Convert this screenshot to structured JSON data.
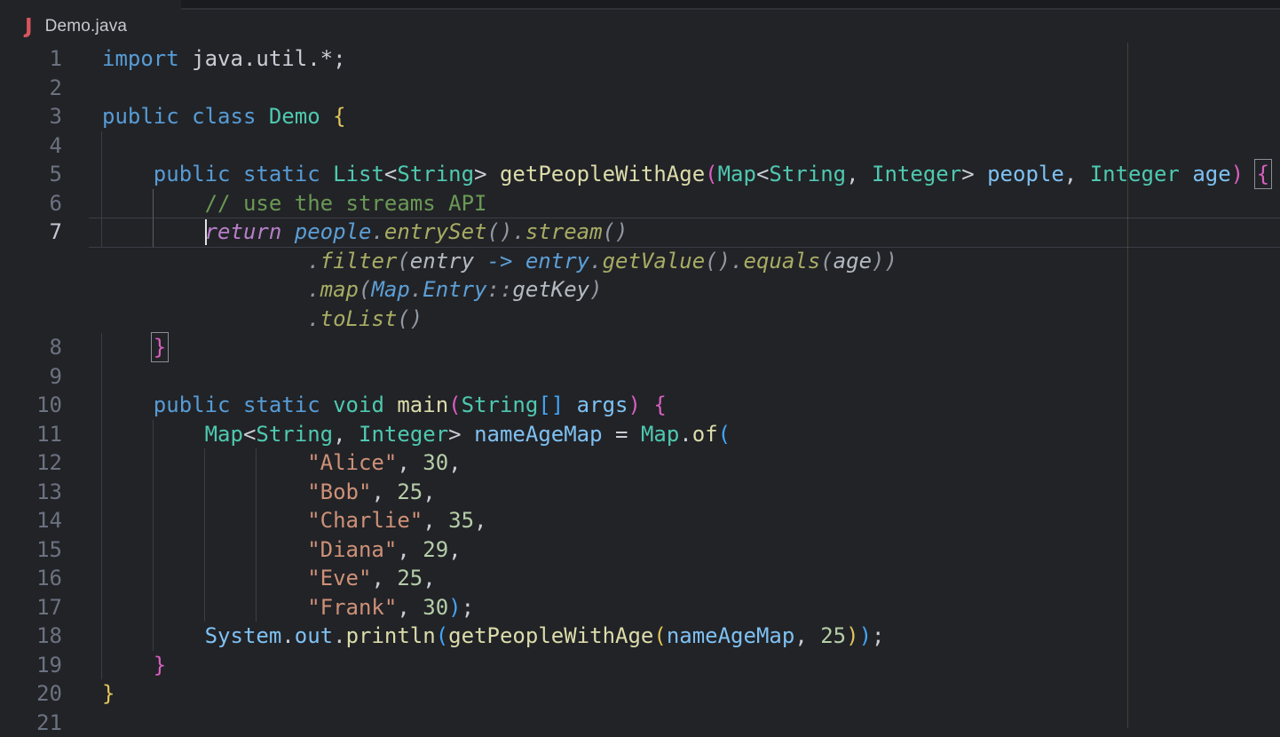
{
  "breadcrumb": {
    "file_icon": "J",
    "filename": "Demo.java"
  },
  "theme": {
    "colors": {
      "bg": "#222327",
      "tabbar": "#1a1b1f",
      "tabborder": "#2e3136",
      "crumb": "#c6c9ce",
      "javaicon": "#d6565e",
      "ln": "#6b7280",
      "lnActive": "#c2c8d2",
      "fg": "#c9cdd5",
      "kw": "#569cd6",
      "ty": "#4ec9b0",
      "fn": "#dcdcaa",
      "var": "#7ec1f2",
      "str": "#ce9178",
      "num": "#b5cea8",
      "com": "#6a9955",
      "b1": "#e2c55b",
      "b2": "#d75fc0",
      "b3": "#42a5f5",
      "gkw": "#b77ec9",
      "gvar": "#5c9fd6",
      "gfn": "#a8ac63",
      "gfg": "#b4bac2",
      "gpun": "#9298a1",
      "guide": "#3b3e45",
      "guideActive": "#585d66",
      "lineBorder": "#3a3e45",
      "match": "#8a8f97",
      "cursor": "#e0e2e6",
      "ruler": "rgba(110,160,110,0.28)"
    }
  },
  "editor": {
    "language": "java",
    "cursor": {
      "line": 7,
      "column": 8
    },
    "ruler_column": 80,
    "lines": [
      {
        "num": "1",
        "tokens": [
          [
            "kw",
            "import"
          ],
          [
            "fg",
            " java.util.*;"
          ]
        ]
      },
      {
        "num": "2",
        "tokens": []
      },
      {
        "num": "3",
        "tokens": [
          [
            "kw",
            "public"
          ],
          [
            "fg",
            " "
          ],
          [
            "kw",
            "class"
          ],
          [
            "fg",
            " "
          ],
          [
            "ty",
            "Demo"
          ],
          [
            "fg",
            " "
          ],
          [
            "b1",
            "{"
          ]
        ]
      },
      {
        "num": "4",
        "tokens": []
      },
      {
        "num": "5",
        "tokens": [
          [
            "fg",
            "    "
          ],
          [
            "kw",
            "public"
          ],
          [
            "fg",
            " "
          ],
          [
            "kw",
            "static"
          ],
          [
            "fg",
            " "
          ],
          [
            "ty",
            "List"
          ],
          [
            "fg",
            "<"
          ],
          [
            "ty",
            "String"
          ],
          [
            "fg",
            "> "
          ],
          [
            "fn",
            "getPeopleWithAge"
          ],
          [
            "b2",
            "("
          ],
          [
            "ty",
            "Map"
          ],
          [
            "fg",
            "<"
          ],
          [
            "ty",
            "String"
          ],
          [
            "fg",
            ", "
          ],
          [
            "ty",
            "Integer"
          ],
          [
            "fg",
            "> "
          ],
          [
            "var",
            "people"
          ],
          [
            "fg",
            ", "
          ],
          [
            "ty",
            "Integer"
          ],
          [
            "fg",
            " "
          ],
          [
            "var",
            "age"
          ],
          [
            "b2",
            ")"
          ],
          [
            "fg",
            " "
          ],
          [
            "b2 match",
            "{"
          ]
        ]
      },
      {
        "num": "6",
        "tokens": [
          [
            "fg",
            "        "
          ],
          [
            "com",
            "// use the streams API"
          ]
        ]
      },
      {
        "num": "7",
        "active": true,
        "tokens": [
          [
            "fg",
            "        "
          ],
          [
            "cursor",
            ""
          ],
          [
            "gkw",
            "return"
          ],
          [
            "gpun",
            " "
          ],
          [
            "gvar",
            "people"
          ],
          [
            "gpun",
            "."
          ],
          [
            "gfn",
            "entrySet"
          ],
          [
            "gpun",
            "()."
          ],
          [
            "gfn",
            "stream"
          ],
          [
            "gpun",
            "()"
          ]
        ]
      },
      {
        "ghost": true,
        "tokens": [
          [
            "gpun",
            "                ."
          ],
          [
            "gfn",
            "filter"
          ],
          [
            "gpun",
            "("
          ],
          [
            "gfg",
            "entry"
          ],
          [
            "gpun",
            " "
          ],
          [
            "gvar",
            "->"
          ],
          [
            "gpun",
            " "
          ],
          [
            "gvar",
            "entry"
          ],
          [
            "gpun",
            "."
          ],
          [
            "gfn",
            "getValue"
          ],
          [
            "gpun",
            "()."
          ],
          [
            "gfn",
            "equals"
          ],
          [
            "gpun",
            "("
          ],
          [
            "gfg",
            "age"
          ],
          [
            "gpun",
            "))"
          ]
        ]
      },
      {
        "ghost": true,
        "tokens": [
          [
            "gpun",
            "                ."
          ],
          [
            "gfn",
            "map"
          ],
          [
            "gpun",
            "("
          ],
          [
            "gvar",
            "Map"
          ],
          [
            "gpun",
            "."
          ],
          [
            "gvar",
            "Entry"
          ],
          [
            "gpun",
            "::"
          ],
          [
            "gfg",
            "getKey"
          ],
          [
            "gpun",
            ")"
          ]
        ]
      },
      {
        "ghost": true,
        "tokens": [
          [
            "gpun",
            "                ."
          ],
          [
            "gfn",
            "toList"
          ],
          [
            "gpun",
            "()"
          ]
        ]
      },
      {
        "num": "8",
        "tokens": [
          [
            "fg",
            "    "
          ],
          [
            "b2 match",
            "}"
          ]
        ]
      },
      {
        "num": "9",
        "tokens": []
      },
      {
        "num": "10",
        "tokens": [
          [
            "fg",
            "    "
          ],
          [
            "kw",
            "public"
          ],
          [
            "fg",
            " "
          ],
          [
            "kw",
            "static"
          ],
          [
            "fg",
            " "
          ],
          [
            "ty",
            "void"
          ],
          [
            "fg",
            " "
          ],
          [
            "fn",
            "main"
          ],
          [
            "b2",
            "("
          ],
          [
            "ty",
            "String"
          ],
          [
            "b3",
            "[]"
          ],
          [
            "fg",
            " "
          ],
          [
            "var",
            "args"
          ],
          [
            "b2",
            ")"
          ],
          [
            "fg",
            " "
          ],
          [
            "b2",
            "{"
          ]
        ]
      },
      {
        "num": "11",
        "tokens": [
          [
            "fg",
            "        "
          ],
          [
            "ty",
            "Map"
          ],
          [
            "fg",
            "<"
          ],
          [
            "ty",
            "String"
          ],
          [
            "fg",
            ", "
          ],
          [
            "ty",
            "Integer"
          ],
          [
            "fg",
            "> "
          ],
          [
            "var",
            "nameAgeMap"
          ],
          [
            "fg",
            " = "
          ],
          [
            "ty",
            "Map"
          ],
          [
            "fg",
            "."
          ],
          [
            "fn",
            "of"
          ],
          [
            "b3",
            "("
          ]
        ]
      },
      {
        "num": "12",
        "tokens": [
          [
            "fg",
            "                "
          ],
          [
            "str",
            "\"Alice\""
          ],
          [
            "fg",
            ", "
          ],
          [
            "num",
            "30"
          ],
          [
            "fg",
            ","
          ]
        ]
      },
      {
        "num": "13",
        "tokens": [
          [
            "fg",
            "                "
          ],
          [
            "str",
            "\"Bob\""
          ],
          [
            "fg",
            ", "
          ],
          [
            "num",
            "25"
          ],
          [
            "fg",
            ","
          ]
        ]
      },
      {
        "num": "14",
        "tokens": [
          [
            "fg",
            "                "
          ],
          [
            "str",
            "\"Charlie\""
          ],
          [
            "fg",
            ", "
          ],
          [
            "num",
            "35"
          ],
          [
            "fg",
            ","
          ]
        ]
      },
      {
        "num": "15",
        "tokens": [
          [
            "fg",
            "                "
          ],
          [
            "str",
            "\"Diana\""
          ],
          [
            "fg",
            ", "
          ],
          [
            "num",
            "29"
          ],
          [
            "fg",
            ","
          ]
        ]
      },
      {
        "num": "16",
        "tokens": [
          [
            "fg",
            "                "
          ],
          [
            "str",
            "\"Eve\""
          ],
          [
            "fg",
            ", "
          ],
          [
            "num",
            "25"
          ],
          [
            "fg",
            ","
          ]
        ]
      },
      {
        "num": "17",
        "tokens": [
          [
            "fg",
            "                "
          ],
          [
            "str",
            "\"Frank\""
          ],
          [
            "fg",
            ", "
          ],
          [
            "num",
            "30"
          ],
          [
            "b3",
            ")"
          ],
          [
            "fg",
            ";"
          ]
        ]
      },
      {
        "num": "18",
        "tokens": [
          [
            "fg",
            "        "
          ],
          [
            "var",
            "System"
          ],
          [
            "fg",
            "."
          ],
          [
            "var",
            "out"
          ],
          [
            "fg",
            "."
          ],
          [
            "fn",
            "println"
          ],
          [
            "b3",
            "("
          ],
          [
            "fn",
            "getPeopleWithAge"
          ],
          [
            "b1",
            "("
          ],
          [
            "var",
            "nameAgeMap"
          ],
          [
            "fg",
            ", "
          ],
          [
            "num",
            "25"
          ],
          [
            "b1",
            ")"
          ],
          [
            "b3",
            ")"
          ],
          [
            "fg",
            ";"
          ]
        ]
      },
      {
        "num": "19",
        "tokens": [
          [
            "fg",
            "    "
          ],
          [
            "b2",
            "}"
          ]
        ]
      },
      {
        "num": "20",
        "tokens": [
          [
            "b1",
            "}"
          ]
        ]
      },
      {
        "num": "21",
        "tokens": []
      }
    ]
  }
}
